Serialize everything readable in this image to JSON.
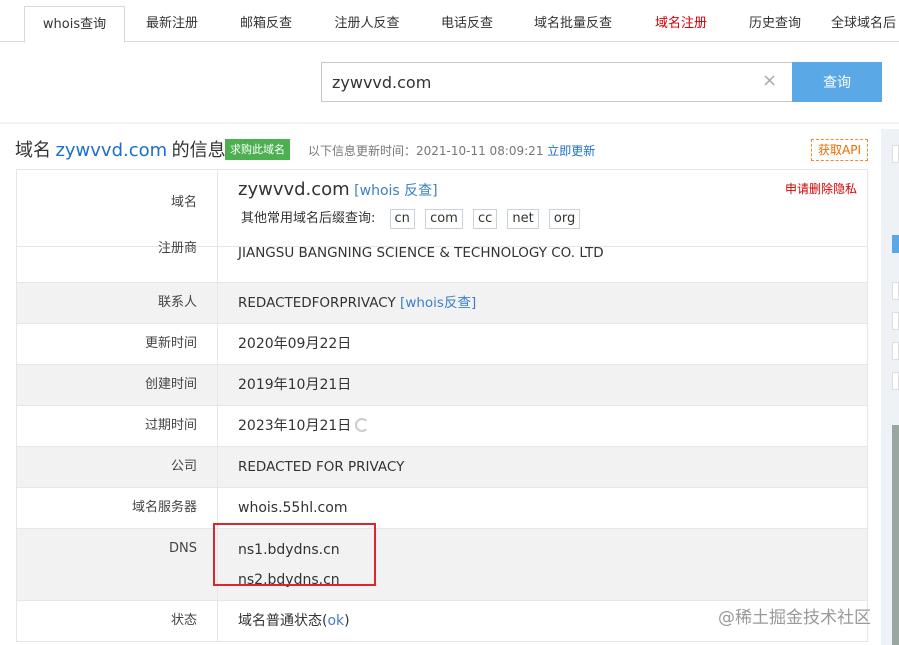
{
  "tabs": [
    {
      "label": "whois查询",
      "active": true,
      "color": "#333333"
    },
    {
      "label": "最新注册",
      "active": false,
      "color": "#333333"
    },
    {
      "label": "邮箱反查",
      "active": false,
      "color": "#333333"
    },
    {
      "label": "注册人反查",
      "active": false,
      "color": "#333333"
    },
    {
      "label": "电话反查",
      "active": false,
      "color": "#333333"
    },
    {
      "label": "域名批量反查",
      "active": false,
      "color": "#333333"
    },
    {
      "label": "域名注册",
      "active": false,
      "color": "#d40000"
    },
    {
      "label": "历史查询",
      "active": false,
      "color": "#333333"
    },
    {
      "label": "全球域名后",
      "active": false,
      "color": "#333333"
    }
  ],
  "search": {
    "value": "zywvvd.com",
    "clear_icon": "×",
    "button_label": "查询"
  },
  "heading": {
    "prefix": "域名",
    "domain": "zywvvd.com",
    "suffix": "的信息",
    "buy_label": "求购此域名",
    "update_text": "以下信息更新时间：2021-10-11 08:09:21",
    "update_link": "立即更新",
    "api_label": "获取API"
  },
  "rows": {
    "domain": {
      "label": "域名",
      "value": "zywvvd.com",
      "whois_link": "[whois 反查]",
      "removal_link": "申请删除隐私",
      "suffix_prompt": "其他常用域名后缀查询:",
      "suffixes": [
        "cn",
        "com",
        "cc",
        "net",
        "org"
      ]
    },
    "registrar": {
      "label": "注册商",
      "value": "JIANGSU BANGNING SCIENCE & TECHNOLOGY CO. LTD"
    },
    "contact": {
      "label": "联系人",
      "value": "REDACTEDFORPRIVACY",
      "link": "[whois反查]"
    },
    "updated": {
      "label": "更新时间",
      "value": "2020年09月22日"
    },
    "created": {
      "label": "创建时间",
      "value": "2019年10月21日"
    },
    "expires": {
      "label": "过期时间",
      "value": "2023年10月21日"
    },
    "company": {
      "label": "公司",
      "value": "REDACTED FOR PRIVACY"
    },
    "whois_server": {
      "label": "域名服务器",
      "value": "whois.55hl.com"
    },
    "dns": {
      "label": "DNS",
      "ns1": "ns1.bdydns.cn",
      "ns2": "ns2.bdydns.cn"
    },
    "status": {
      "label": "状态",
      "prefix": "域名普通状态(",
      "link": "ok",
      "suffix": ")"
    }
  },
  "watermark": "@稀土掘金技术社区",
  "colors": {
    "accent": "#5aa9e6",
    "link": "#1a6fc9",
    "buy_green": "#4caf50",
    "highlight_red": "#e0242b",
    "api_orange": "#f06a00"
  }
}
